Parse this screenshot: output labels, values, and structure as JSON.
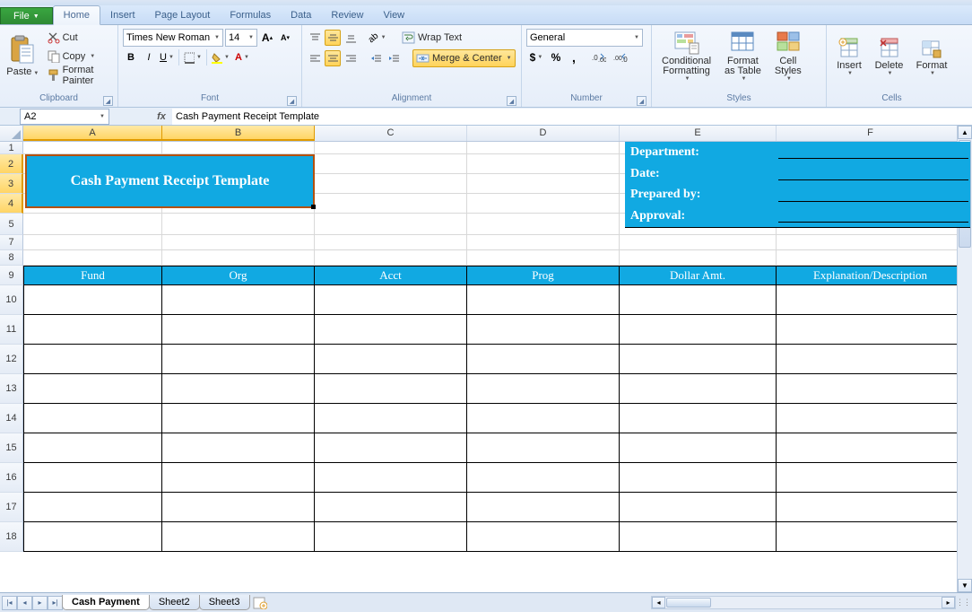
{
  "tabs": {
    "file": "File",
    "home": "Home",
    "insert": "Insert",
    "pageLayout": "Page Layout",
    "formulas": "Formulas",
    "data": "Data",
    "review": "Review",
    "view": "View"
  },
  "clipboard": {
    "paste": "Paste",
    "cut": "Cut",
    "copy": "Copy",
    "formatPainter": "Format Painter",
    "group": "Clipboard"
  },
  "font": {
    "name": "Times New Roman",
    "size": "14",
    "group": "Font"
  },
  "alignment": {
    "wrap": "Wrap Text",
    "merge": "Merge & Center",
    "group": "Alignment"
  },
  "number": {
    "format": "General",
    "group": "Number"
  },
  "styles": {
    "cond": "Conditional\nFormatting",
    "table": "Format\nas Table",
    "cell": "Cell\nStyles",
    "group": "Styles"
  },
  "cells": {
    "insert": "Insert",
    "delete": "Delete",
    "format": "Format",
    "group": "Cells"
  },
  "namebox": "A2",
  "formula": "Cash Payment Receipt Template",
  "cols": [
    "A",
    "B",
    "C",
    "D",
    "E",
    "F"
  ],
  "rowNums": [
    "1",
    "2",
    "3",
    "4",
    "5",
    "7",
    "8",
    "9",
    "10",
    "11",
    "12",
    "13",
    "14",
    "15",
    "16",
    "17",
    "18"
  ],
  "titleCell": "Cash Payment Receipt Template",
  "info": {
    "dept": "Department:",
    "date": "Date:",
    "prep": "Prepared by:",
    "appr": "Approval:"
  },
  "headers": {
    "fund": "Fund",
    "org": "Org",
    "acct": "Acct",
    "prog": "Prog",
    "amt": "Dollar Amt.",
    "desc": "Explanation/Description"
  },
  "sheets": {
    "s1": "Cash Payment",
    "s2": "Sheet2",
    "s3": "Sheet3"
  }
}
